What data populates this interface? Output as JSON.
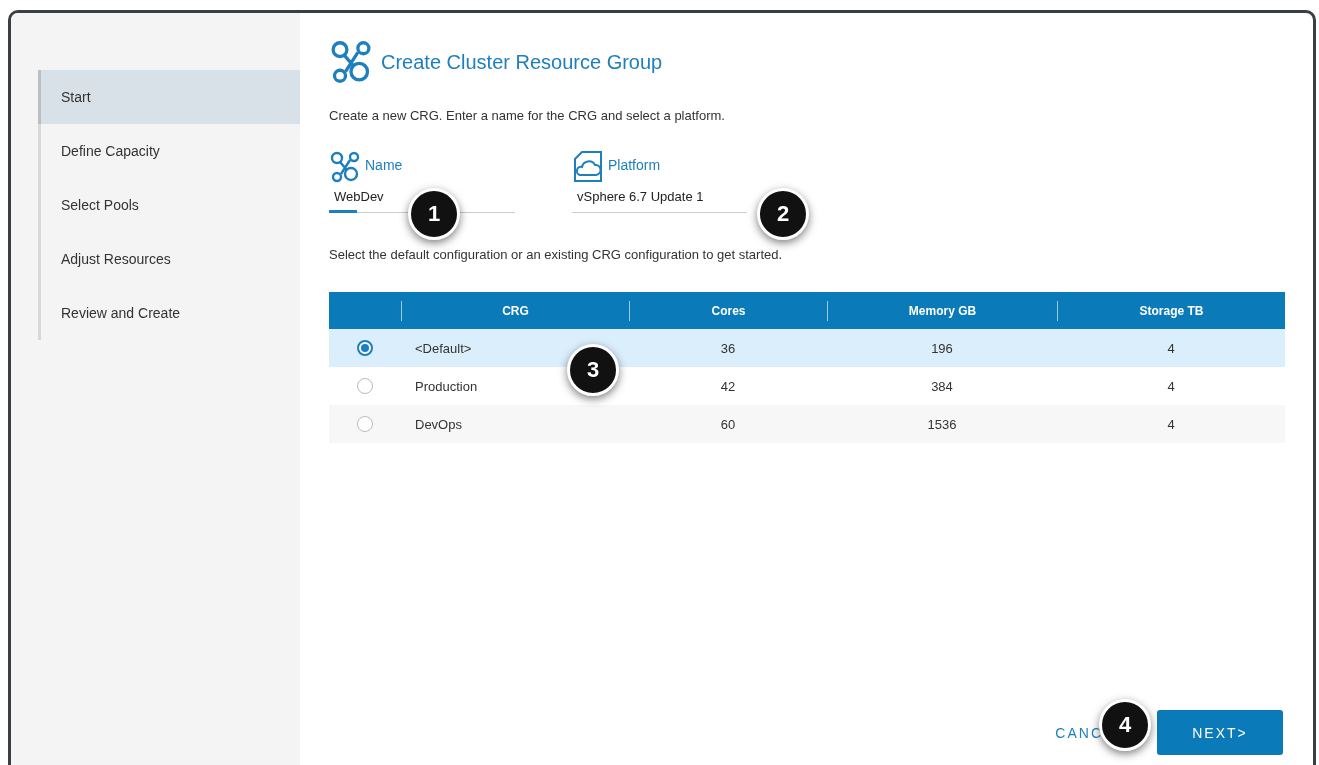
{
  "sidebar": {
    "items": [
      {
        "label": "Start",
        "selected": true
      },
      {
        "label": "Define Capacity",
        "selected": false
      },
      {
        "label": "Select Pools",
        "selected": false
      },
      {
        "label": "Adjust Resources",
        "selected": false
      },
      {
        "label": "Review and Create",
        "selected": false
      }
    ]
  },
  "title": "Create Cluster Resource Group",
  "intro": "Create a new CRG. Enter a name for the CRG and select a platform.",
  "fields": [
    {
      "kind": "cluster",
      "label": "Name",
      "value": "WebDev"
    },
    {
      "kind": "cloud",
      "label": "Platform",
      "value": "vSphere 6.7 Update 1"
    }
  ],
  "hint": "Select the default configuration or an existing CRG configuration to get started.",
  "table": {
    "columns": [
      "CRG",
      "Cores",
      "Memory GB",
      "Storage TB"
    ],
    "rows": [
      {
        "selected": true,
        "cells": [
          "<Default>",
          "36",
          "196",
          "4"
        ]
      },
      {
        "selected": false,
        "cells": [
          "Production",
          "42",
          "384",
          "4"
        ]
      },
      {
        "selected": false,
        "cells": [
          "DevOps",
          "60",
          "1536",
          "4"
        ]
      }
    ]
  },
  "buttons": {
    "cancel": "CANC",
    "next": "NEXT>"
  },
  "callouts": [
    {
      "label": "1"
    },
    {
      "label": "2"
    },
    {
      "label": "3"
    },
    {
      "label": "4"
    }
  ]
}
